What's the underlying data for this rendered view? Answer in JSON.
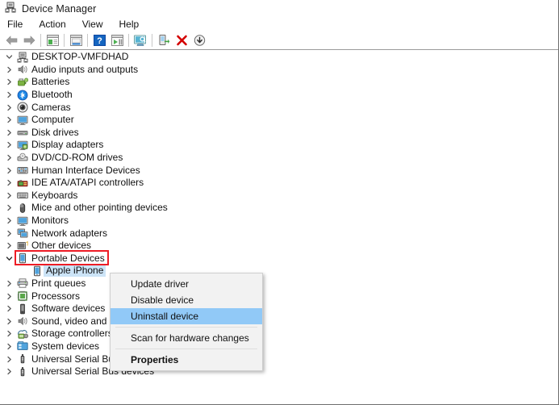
{
  "window": {
    "title": "Device Manager",
    "title_icon": "device-manager-icon"
  },
  "menubar": {
    "items": [
      {
        "label": "File",
        "name": "menu-file"
      },
      {
        "label": "Action",
        "name": "menu-action"
      },
      {
        "label": "View",
        "name": "menu-view"
      },
      {
        "label": "Help",
        "name": "menu-help"
      }
    ]
  },
  "toolbar": {
    "buttons": [
      {
        "icon": "back-arrow-icon",
        "title": "Back"
      },
      {
        "icon": "forward-arrow-icon",
        "title": "Forward"
      },
      {
        "icon": "show-hide-console-tree-icon",
        "title": "Show/Hide Console Tree"
      },
      {
        "icon": "properties-icon",
        "title": "Properties"
      },
      {
        "icon": "help-icon",
        "title": "Help"
      },
      {
        "icon": "update-driver-icon",
        "title": "Update driver"
      },
      {
        "icon": "scan-hardware-changes-icon",
        "title": "Scan for hardware changes"
      },
      {
        "icon": "enable-device-icon",
        "title": "Enable device"
      },
      {
        "icon": "uninstall-device-icon",
        "title": "Uninstall device"
      },
      {
        "icon": "disable-device-icon",
        "title": "Disable device"
      }
    ]
  },
  "tree": {
    "root": {
      "label": "DESKTOP-VMFDHAD",
      "icon": "computer-root-icon",
      "expanded": true
    },
    "items": [
      {
        "label": "Audio inputs and outputs",
        "icon": "speaker-icon",
        "indent": 1,
        "expandable": true
      },
      {
        "label": "Batteries",
        "icon": "battery-icon",
        "indent": 1,
        "expandable": true
      },
      {
        "label": "Bluetooth",
        "icon": "bluetooth-icon",
        "indent": 1,
        "expandable": true
      },
      {
        "label": "Cameras",
        "icon": "camera-icon",
        "indent": 1,
        "expandable": true
      },
      {
        "label": "Computer",
        "icon": "monitor-icon",
        "indent": 1,
        "expandable": true
      },
      {
        "label": "Disk drives",
        "icon": "disk-drive-icon",
        "indent": 1,
        "expandable": true
      },
      {
        "label": "Display adapters",
        "icon": "display-adapter-icon",
        "indent": 1,
        "expandable": true
      },
      {
        "label": "DVD/CD-ROM drives",
        "icon": "dvd-drive-icon",
        "indent": 1,
        "expandable": true
      },
      {
        "label": "Human Interface Devices",
        "icon": "hid-icon",
        "indent": 1,
        "expandable": true
      },
      {
        "label": "IDE ATA/ATAPI controllers",
        "icon": "ide-controller-icon",
        "indent": 1,
        "expandable": true
      },
      {
        "label": "Keyboards",
        "icon": "keyboard-icon",
        "indent": 1,
        "expandable": true
      },
      {
        "label": "Mice and other pointing devices",
        "icon": "mouse-icon",
        "indent": 1,
        "expandable": true
      },
      {
        "label": "Monitors",
        "icon": "monitor-icon",
        "indent": 1,
        "expandable": true
      },
      {
        "label": "Network adapters",
        "icon": "network-adapter-icon",
        "indent": 1,
        "expandable": true
      },
      {
        "label": "Other devices",
        "icon": "other-device-icon",
        "indent": 1,
        "expandable": true
      },
      {
        "label": "Portable Devices",
        "icon": "portable-device-icon",
        "indent": 1,
        "expandable": true,
        "expanded": true,
        "highlighted": true
      },
      {
        "label": "Apple iPhone",
        "icon": "portable-device-icon",
        "indent": 2,
        "expandable": false,
        "selected": true
      },
      {
        "label": "Print queues",
        "icon": "printer-icon",
        "indent": 1,
        "expandable": true
      },
      {
        "label": "Processors",
        "icon": "processor-icon",
        "indent": 1,
        "expandable": true
      },
      {
        "label": "Software devices",
        "icon": "software-device-icon",
        "indent": 1,
        "expandable": true
      },
      {
        "label": "Sound, video and game controllers",
        "icon": "speaker-icon",
        "indent": 1,
        "expandable": true
      },
      {
        "label": "Storage controllers",
        "icon": "storage-controller-icon",
        "indent": 1,
        "expandable": true
      },
      {
        "label": "System devices",
        "icon": "system-device-icon",
        "indent": 1,
        "expandable": true
      },
      {
        "label": "Universal Serial Bus controllers",
        "icon": "usb-icon",
        "indent": 1,
        "expandable": true
      },
      {
        "label": "Universal Serial Bus devices",
        "icon": "usb-icon",
        "indent": 1,
        "expandable": true
      }
    ]
  },
  "context_menu": {
    "items": [
      {
        "label": "Update driver",
        "type": "item",
        "name": "ctx-update-driver"
      },
      {
        "label": "Disable device",
        "type": "item",
        "name": "ctx-disable-device"
      },
      {
        "label": "Uninstall device",
        "type": "item",
        "name": "ctx-uninstall-device",
        "highlighted": true
      },
      {
        "type": "separator"
      },
      {
        "label": "Scan for hardware changes",
        "type": "item",
        "name": "ctx-scan-hardware-changes"
      },
      {
        "type": "separator"
      },
      {
        "label": "Properties",
        "type": "item",
        "name": "ctx-properties",
        "bold": true
      }
    ]
  },
  "colors": {
    "menu_highlight": "#91c9f7",
    "tree_selection": "#cce4f7",
    "annotation_red": "#ee1c25",
    "menu_background": "#f2f2f2"
  }
}
